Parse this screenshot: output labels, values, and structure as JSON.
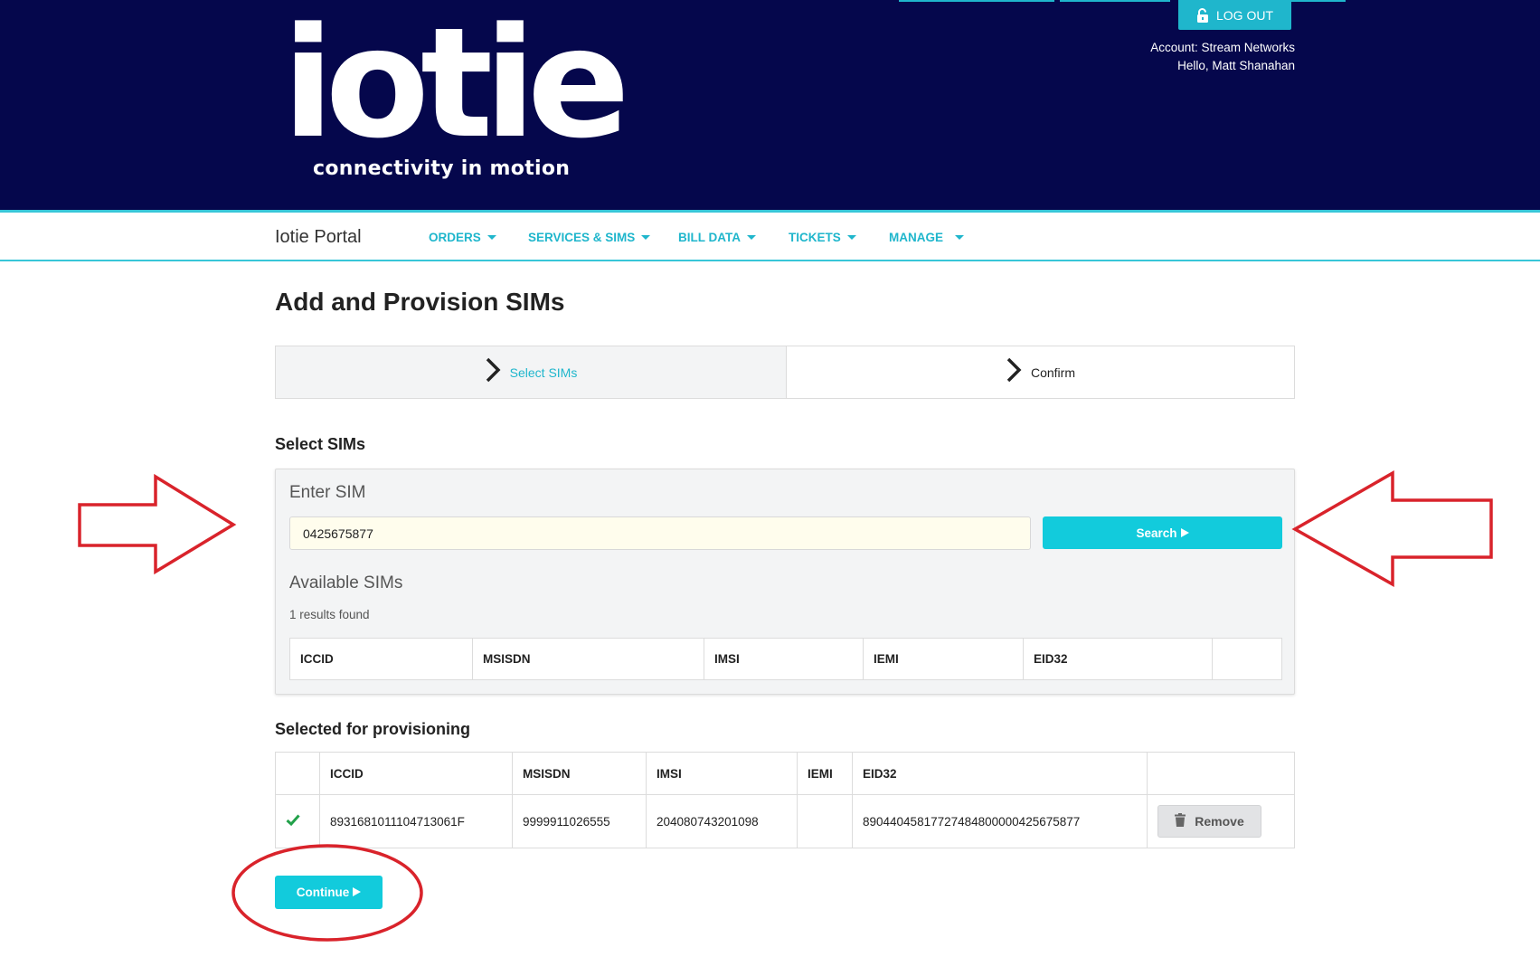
{
  "header": {
    "logo_text": "iotie",
    "tagline": "connectivity in motion",
    "logout_label": "LOG OUT",
    "account_text": "Account: Stream Networks",
    "hello_text": "Hello, Matt Shanahan"
  },
  "nav": {
    "brand": "Iotie Portal",
    "items": [
      {
        "label": "ORDERS"
      },
      {
        "label": "SERVICES & SIMS"
      },
      {
        "label": "BILL DATA"
      },
      {
        "label": "TICKETS"
      },
      {
        "label": "MANAGE"
      }
    ]
  },
  "page": {
    "title": "Add and Provision SIMs"
  },
  "stepper": {
    "steps": [
      {
        "label": "Select SIMs",
        "active": true
      },
      {
        "label": "Confirm",
        "active": false
      }
    ]
  },
  "select_sims": {
    "heading": "Select SIMs",
    "enter_label": "Enter SIM",
    "input_value": "0425675877",
    "search_label": "Search",
    "available_label": "Available SIMs",
    "results_text": "1 results found",
    "columns": [
      "ICCID",
      "MSISDN",
      "IMSI",
      "IEMI",
      "EID32",
      ""
    ]
  },
  "selected": {
    "heading": "Selected for provisioning",
    "columns": [
      "",
      "ICCID",
      "MSISDN",
      "IMSI",
      "IEMI",
      "EID32",
      ""
    ],
    "rows": [
      {
        "iccid": "8931681011104713061F",
        "msisdn": "9999911026555",
        "imsi": "204080743201098",
        "iemi": "",
        "eid32": "89044045817727484800000425675877",
        "remove_label": "Remove"
      }
    ]
  },
  "continue_label": "Continue",
  "icons": {
    "logout": "lock-open-icon",
    "step": "chevron-right-icon",
    "play": "play-triangle-icon",
    "check": "check-icon",
    "trash": "trash-icon"
  },
  "colors": {
    "header_bg": "#05074c",
    "accent": "#1fb6cc",
    "button": "#12cbdc",
    "annotation": "#d9232b",
    "check": "#22a14a"
  }
}
